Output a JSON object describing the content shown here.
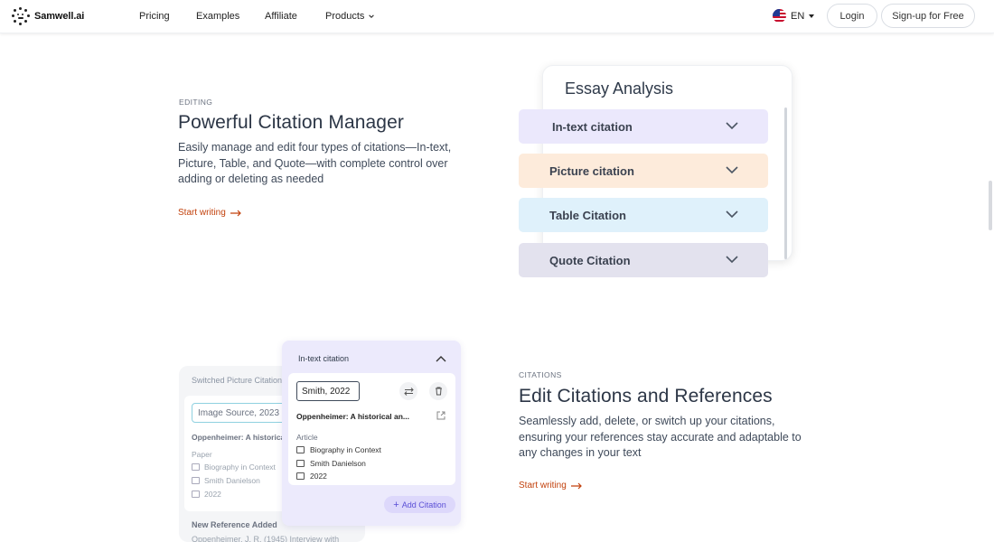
{
  "header": {
    "brand": "Samwell.ai",
    "nav": [
      "Pricing",
      "Examples",
      "Affiliate",
      "Products"
    ],
    "lang": "EN",
    "login": "Login",
    "signup": "Sign-up for Free"
  },
  "section1": {
    "eyebrow": "EDITING",
    "title": "Powerful Citation Manager",
    "description": "Easily manage and edit four types of citations—In-text, Picture, Table, and Quote—with complete control over adding or deleting as needed",
    "cta": "Start writing"
  },
  "essay": {
    "title": "Essay Analysis",
    "items": [
      {
        "label": "In-text citation",
        "color": "#ebe8fc"
      },
      {
        "label": "Picture citation",
        "color": "#fdebdb"
      },
      {
        "label": "Table Citation",
        "color": "#dff1fb"
      },
      {
        "label": "Quote Citation",
        "color": "#e3e2ee"
      }
    ]
  },
  "section2": {
    "eyebrow": "CITATIONS",
    "title": "Edit Citations and References",
    "description": "Seamlessly add, delete, or switch up your citations, ensuring your references stay accurate and adaptable to any changes in your text",
    "cta": "Start writing"
  },
  "mock_back": {
    "title": "Switched Picture Citation",
    "input": "Image Source, 2023",
    "ref": "Oppenheimer: A historical analysis",
    "type": "Paper",
    "source": "Biography in Context",
    "author": "Smith Danielson",
    "year": "2022",
    "new_ref_title": "New Reference Added",
    "new_ref_text": "Oppenheimer, J. R. (1945) Interview with"
  },
  "mock_front": {
    "title": "In-text citation",
    "input": "Smith, 2022",
    "ref": "Oppenheimer: A historical an...",
    "type": "Article",
    "source": "Biography in Context",
    "author": "Smith Danielson",
    "year": "2022",
    "add_label": "Add Citation"
  },
  "colors": {
    "accent_cta": "#c2410c",
    "add_button": "#5b4fd6"
  }
}
